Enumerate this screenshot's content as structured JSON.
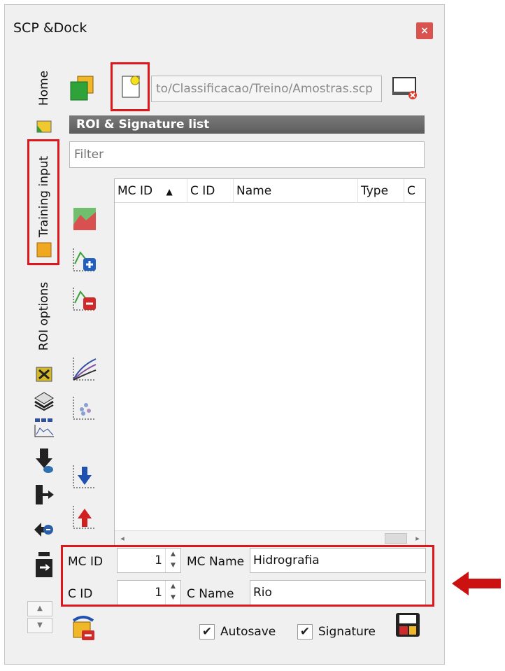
{
  "window": {
    "title": "SCP &Dock",
    "close_glyph": "×"
  },
  "tabs": [
    {
      "label": "Home",
      "icon": "home-tab-icon"
    },
    {
      "label": "Training input",
      "icon": "training-input-tab-icon"
    },
    {
      "label": "ROI options",
      "icon": "roi-options-tab-icon"
    }
  ],
  "toolbar": {
    "path": "to/Classificacao/Treino/Amostras.scp",
    "create_icon": "create-training-input-icon",
    "open_icon": "open-training-input-icon",
    "reset_icon": "reset-input-icon"
  },
  "roi_list": {
    "header": "ROI & Signature list",
    "filter_placeholder": "Filter",
    "columns": [
      "MC ID",
      "C ID",
      "Name",
      "Type",
      "C"
    ],
    "sort_indicator": "▲",
    "scroll_left": "◂",
    "scroll_right": "▸"
  },
  "class_fields": {
    "mc_id_label": "MC ID",
    "mc_id_value": "1",
    "mc_name_label": "MC Name",
    "mc_name_value": "Hidrografia",
    "c_id_label": "C ID",
    "c_id_value": "1",
    "c_name_label": "C Name",
    "c_name_value": "Rio",
    "spin_arrows": "▲\n▼"
  },
  "options": {
    "autosave_label": "Autosave",
    "autosave_checked": "✔",
    "signature_label": "Signature",
    "signature_checked": "✔"
  },
  "stepper": {
    "up": "▲",
    "down": "▼"
  },
  "colors": {
    "highlight": "#e0161d",
    "arrow": "#cc1111",
    "header_bg": "#666666"
  }
}
